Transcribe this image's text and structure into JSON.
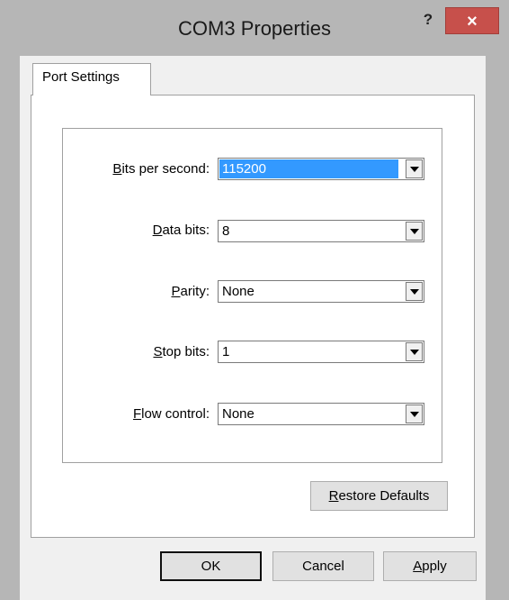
{
  "window": {
    "title": "COM3 Properties",
    "help_label": "?",
    "close_label": "×"
  },
  "tabs": [
    {
      "label": "Port Settings",
      "selected": true
    }
  ],
  "fields": [
    {
      "label_pre": "",
      "label_key": "B",
      "label_post": "its per second:",
      "value": "115200",
      "selected": true
    },
    {
      "label_pre": "",
      "label_key": "D",
      "label_post": "ata bits:",
      "value": "8",
      "selected": false
    },
    {
      "label_pre": "",
      "label_key": "P",
      "label_post": "arity:",
      "value": "None",
      "selected": false
    },
    {
      "label_pre": "",
      "label_key": "S",
      "label_post": "top bits:",
      "value": "1",
      "selected": false
    },
    {
      "label_pre": "",
      "label_key": "F",
      "label_post": "low control:",
      "value": "None",
      "selected": false
    }
  ],
  "buttons": {
    "restore": {
      "key": "R",
      "rest": "estore Defaults"
    },
    "ok": "OK",
    "cancel": "Cancel",
    "apply": {
      "key": "A",
      "rest": "pply"
    }
  },
  "colors": {
    "selection": "#3399ff",
    "close": "#c7504b",
    "frame": "#b6b6b6"
  }
}
